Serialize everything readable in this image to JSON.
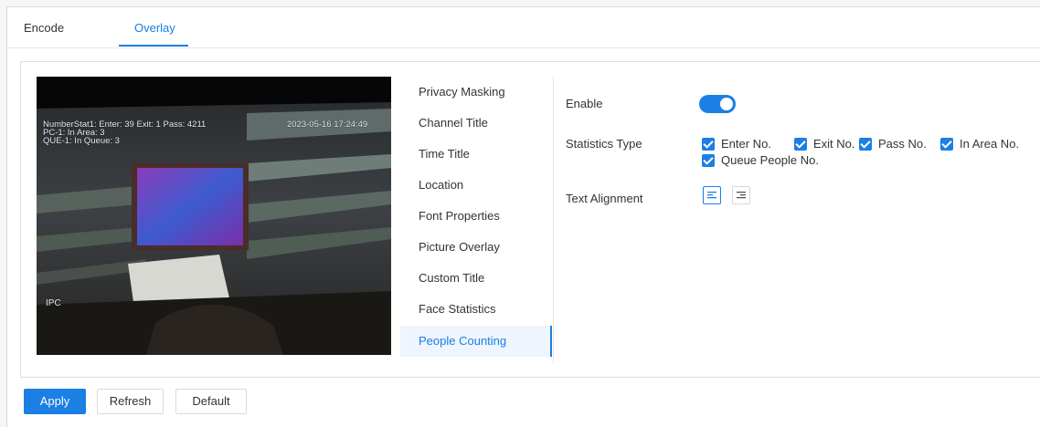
{
  "tabs": [
    {
      "label": "Encode",
      "active": false
    },
    {
      "label": "Overlay",
      "active": true
    }
  ],
  "video": {
    "osd_line1": "NumberStat1: Enter: 39 Exit: 1   Pass: 4211",
    "osd_line2": "PC-1: In Area: 3",
    "osd_line3": "QUE-1: In Queue: 3",
    "osd_time": "2023-05-16 17:24:49",
    "osd_channel": "IPC"
  },
  "menu": {
    "items": [
      "Privacy Masking",
      "Channel Title",
      "Time Title",
      "Location",
      "Font Properties",
      "Picture Overlay",
      "Custom Title",
      "Face Statistics",
      "People Counting"
    ],
    "active_index": 8
  },
  "settings": {
    "enable_label": "Enable",
    "enable_value": true,
    "statistics_type_label": "Statistics Type",
    "statistics_types": [
      {
        "label": "Enter No.",
        "checked": true
      },
      {
        "label": "Exit No.",
        "checked": true
      },
      {
        "label": "Pass No.",
        "checked": true
      },
      {
        "label": "In Area No.",
        "checked": true
      },
      {
        "label": "Queue People No.",
        "checked": true
      }
    ],
    "text_alignment_label": "Text Alignment",
    "text_alignment_options": [
      "align-left-icon",
      "align-right-icon"
    ],
    "text_alignment_selected": "left"
  },
  "buttons": {
    "apply": "Apply",
    "refresh": "Refresh",
    "default": "Default"
  },
  "colors": {
    "accent": "#1b7fe3",
    "active_menu_bg": "#eef5fe"
  }
}
